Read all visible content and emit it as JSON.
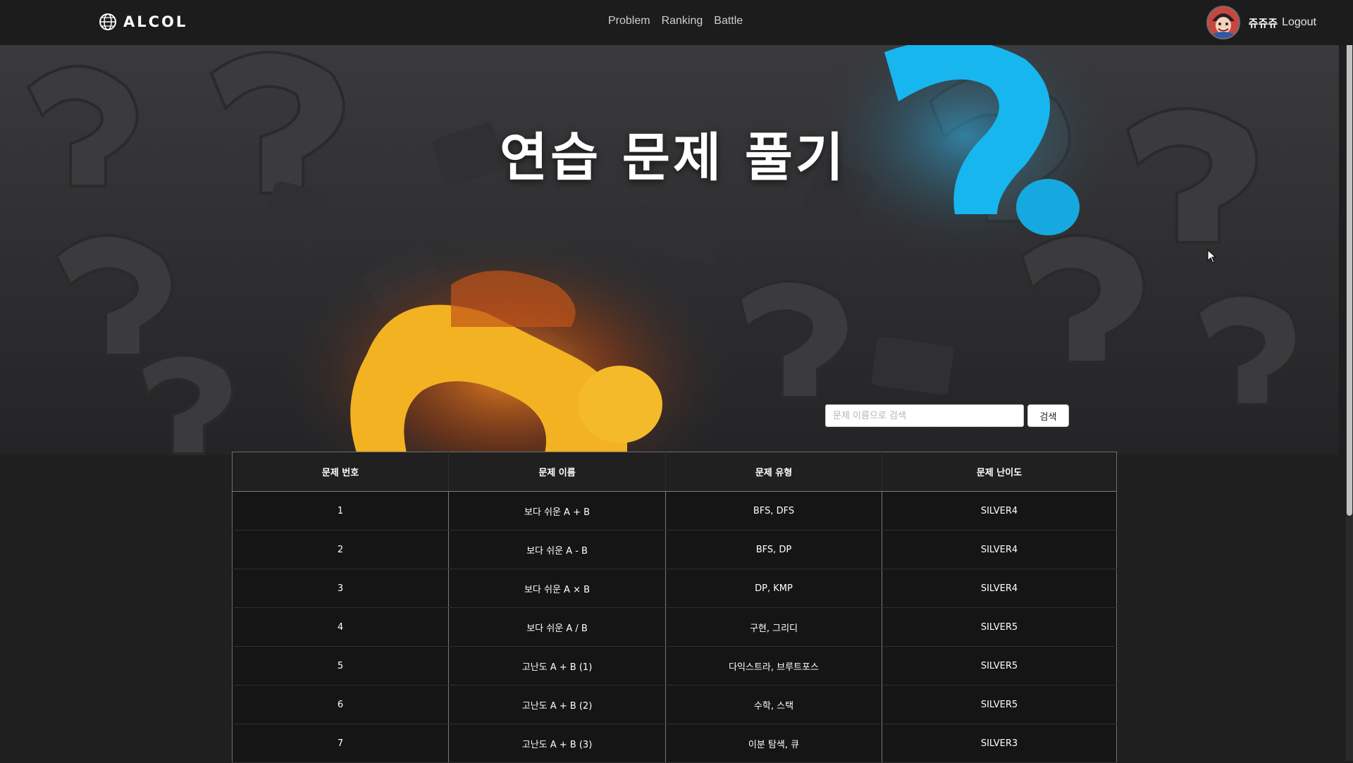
{
  "nav": {
    "logo_text": "ALCOL",
    "links": [
      "Problem",
      "Ranking",
      "Battle"
    ],
    "username": "쥬쥬쥬",
    "logout": "Logout"
  },
  "hero": {
    "title": "연습 문제 풀기"
  },
  "search": {
    "placeholder": "문제 이름으로 검색",
    "button": "검색"
  },
  "table": {
    "headers": [
      "문제 번호",
      "문제 이름",
      "문제 유형",
      "문제 난이도"
    ],
    "rows": [
      [
        "1",
        "보다 쉬운 A + B",
        "BFS, DFS",
        "SILVER4"
      ],
      [
        "2",
        "보다 쉬운 A - B",
        "BFS, DP",
        "SILVER4"
      ],
      [
        "3",
        "보다 쉬운 A × B",
        "DP, KMP",
        "SILVER4"
      ],
      [
        "4",
        "보다 쉬운 A / B",
        "구현, 그리디",
        "SILVER5"
      ],
      [
        "5",
        "고난도 A + B (1)",
        "다익스트라, 브루트포스",
        "SILVER5"
      ],
      [
        "6",
        "고난도 A + B (2)",
        "수학, 스택",
        "SILVER5"
      ],
      [
        "7",
        "고난도 A + B (3)",
        "이분 탐색, 큐",
        "SILVER3"
      ]
    ]
  },
  "colors": {
    "page_bg": "#1f1f1f",
    "nav_bg": "#1c1c1c",
    "hero_yellow": "#f3b221",
    "hero_blue": "#1fb6ee",
    "table_bg": "#151515"
  }
}
